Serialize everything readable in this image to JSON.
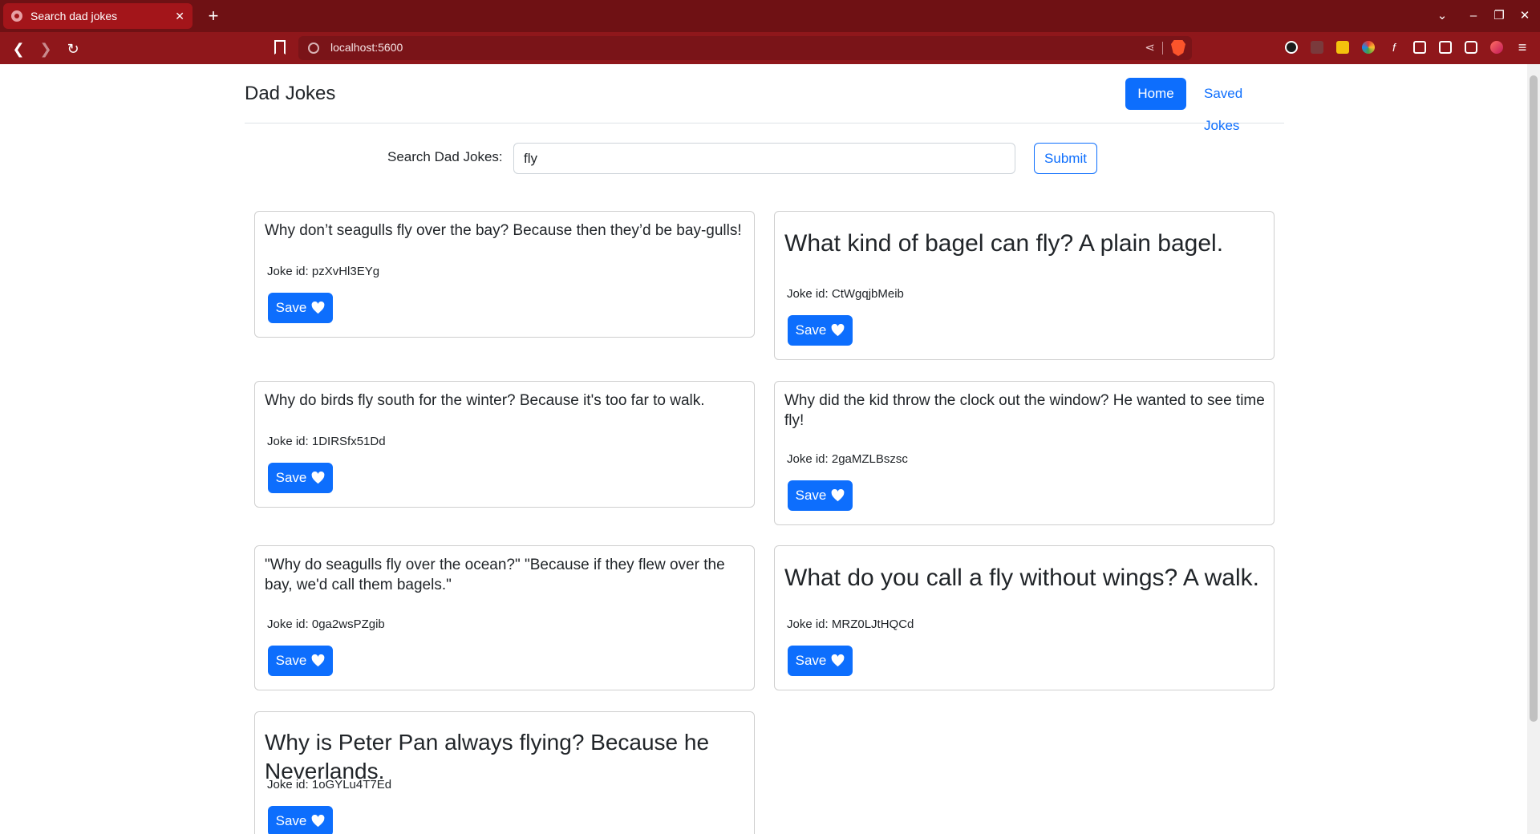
{
  "browser": {
    "tab_title": "Search dad jokes",
    "tab_close": "✕",
    "new_tab": "+",
    "url": "localhost:5600",
    "colors": {
      "tabbar": "#6f1114",
      "toolbar": "#8f171b",
      "accent": "#0d6efd"
    }
  },
  "header": {
    "brand": "Dad Jokes",
    "nav": {
      "home": "Home",
      "saved": "Saved Jokes"
    }
  },
  "search": {
    "label": "Search Dad Jokes:",
    "value": "fly",
    "submit": "Submit"
  },
  "jokes": [
    {
      "text": "Why don’t seagulls fly over the bay? Because then they’d be bay-gulls!",
      "id_label": "Joke id: pzXvHl3EYg",
      "save": "Save"
    },
    {
      "text": "What kind of bagel can fly? A plain bagel.",
      "id_label": "Joke id: CtWgqjbMeib",
      "save": "Save"
    },
    {
      "text": "Why do birds fly south for the winter? Because it's too far to walk.",
      "id_label": "Joke id: 1DIRSfx51Dd",
      "save": "Save"
    },
    {
      "text": "Why did the kid throw the clock out the window? He wanted to see time fly!",
      "id_label": "Joke id: 2gaMZLBszsc",
      "save": "Save"
    },
    {
      "text": "\"Why do seagulls fly over the ocean?\" \"Because if they flew over the bay, we'd call them bagels.\"",
      "id_label": "Joke id: 0ga2wsPZgib",
      "save": "Save"
    },
    {
      "text": "What do you call a fly without wings? A walk.",
      "id_label": "Joke id: MRZ0LJtHQCd",
      "save": "Save"
    },
    {
      "text": "Why is Peter Pan always flying? Because he Neverlands.",
      "id_label": "Joke id: 1oGYLu4T7Ed",
      "save": "Save"
    }
  ]
}
